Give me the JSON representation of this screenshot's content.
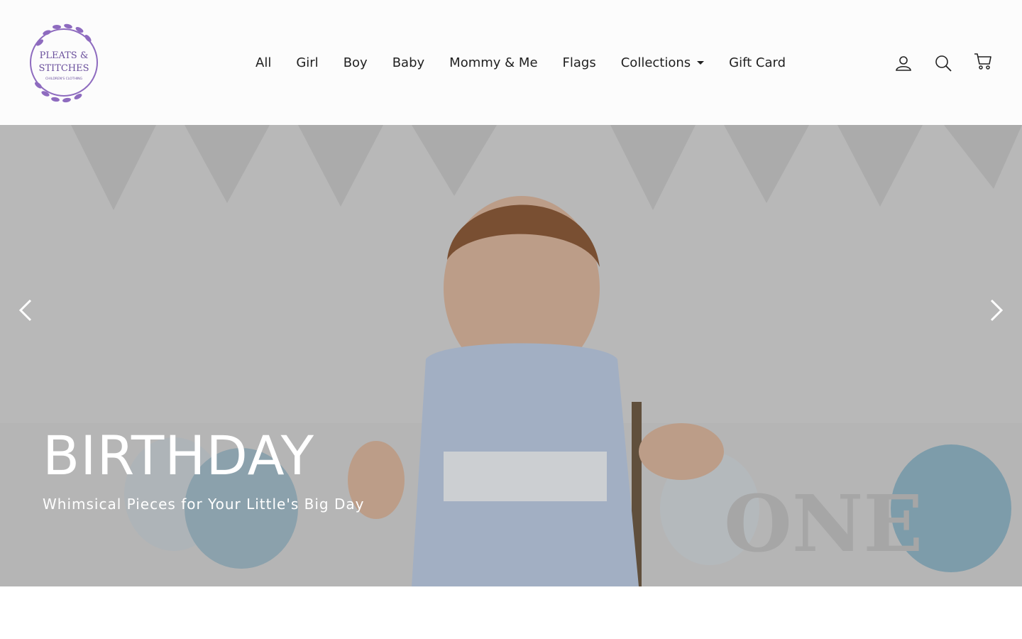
{
  "brand": {
    "logo_line1": "PLEATS &",
    "logo_line2": "STITCHES",
    "logo_tagline": "CHILDREN'S CLOTHING",
    "accent": "#8e6bbf"
  },
  "nav": {
    "items": [
      {
        "label": "All",
        "name": "nav-all"
      },
      {
        "label": "Girl",
        "name": "nav-girl"
      },
      {
        "label": "Boy",
        "name": "nav-boy"
      },
      {
        "label": "Baby",
        "name": "nav-baby"
      },
      {
        "label": "Mommy & Me",
        "name": "nav-mommy-and-me"
      },
      {
        "label": "Flags",
        "name": "nav-flags"
      },
      {
        "label": "Collections",
        "name": "nav-collections",
        "dropdown": true
      },
      {
        "label": "Gift Card",
        "name": "nav-gift-card"
      }
    ]
  },
  "header_icons": {
    "account": "user-icon",
    "search": "search-icon",
    "cart": "cart-icon"
  },
  "hero": {
    "title": "BIRTHDAY",
    "subtitle": "Whimsical Pieces for Your Little's Big Day",
    "prev_icon": "chevron-left-icon",
    "next_icon": "chevron-right-icon",
    "image_alt_props": [
      "pennant-banner",
      "gingham-bubble-romper",
      "balloons",
      "ONE-letters"
    ]
  }
}
